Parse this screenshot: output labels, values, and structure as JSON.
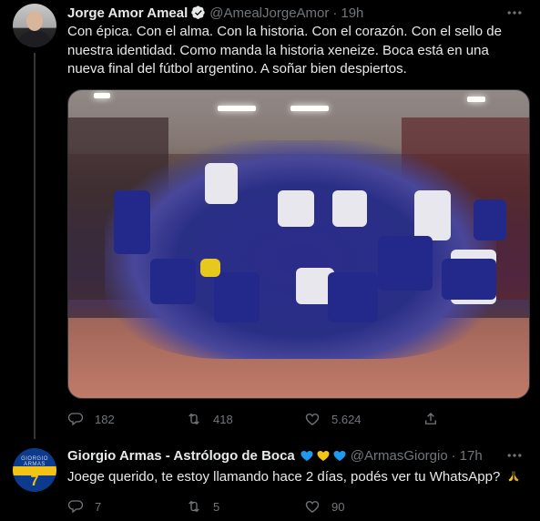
{
  "tweet": {
    "author_name": "Jorge Amor Ameal",
    "handle": "@AmealJorgeAmor",
    "separator": "·",
    "time": "19h",
    "text": "Con épica. Con el alma. Con la historia. Con el corazón. Con el sello de nuestra identidad. Como manda la historia xeneize. Boca está en una nueva final del fútbol argentino. A soñar bien despiertos.",
    "stats": {
      "replies": "182",
      "retweets": "418",
      "likes": "5.624"
    }
  },
  "reply": {
    "author_name": "Giorgio Armas - Astrólogo de Boca",
    "hearts": [
      "#1d9bf0",
      "#f3c316",
      "#1d9bf0"
    ],
    "handle": "@ArmasGiorgio",
    "separator": "·",
    "time": "17h",
    "text": "Joege querido, te estoy llamando hace 2 días, podés ver tu WhatsApp?",
    "avatar_number": "7",
    "avatar_text": "GIORGIO ARMAS",
    "stats": {
      "replies": "7",
      "retweets": "5",
      "likes": "90"
    }
  },
  "icons": [
    "verified-badge-icon",
    "more-icon",
    "reply-icon",
    "retweet-icon",
    "like-icon",
    "share-icon",
    "pray-hands-icon",
    "heart-icon"
  ],
  "colors": {
    "background": "#000000",
    "text": "#e7e9ea",
    "muted": "#71767b",
    "verified": "#1d9bf0",
    "divider": "#2f3336"
  }
}
